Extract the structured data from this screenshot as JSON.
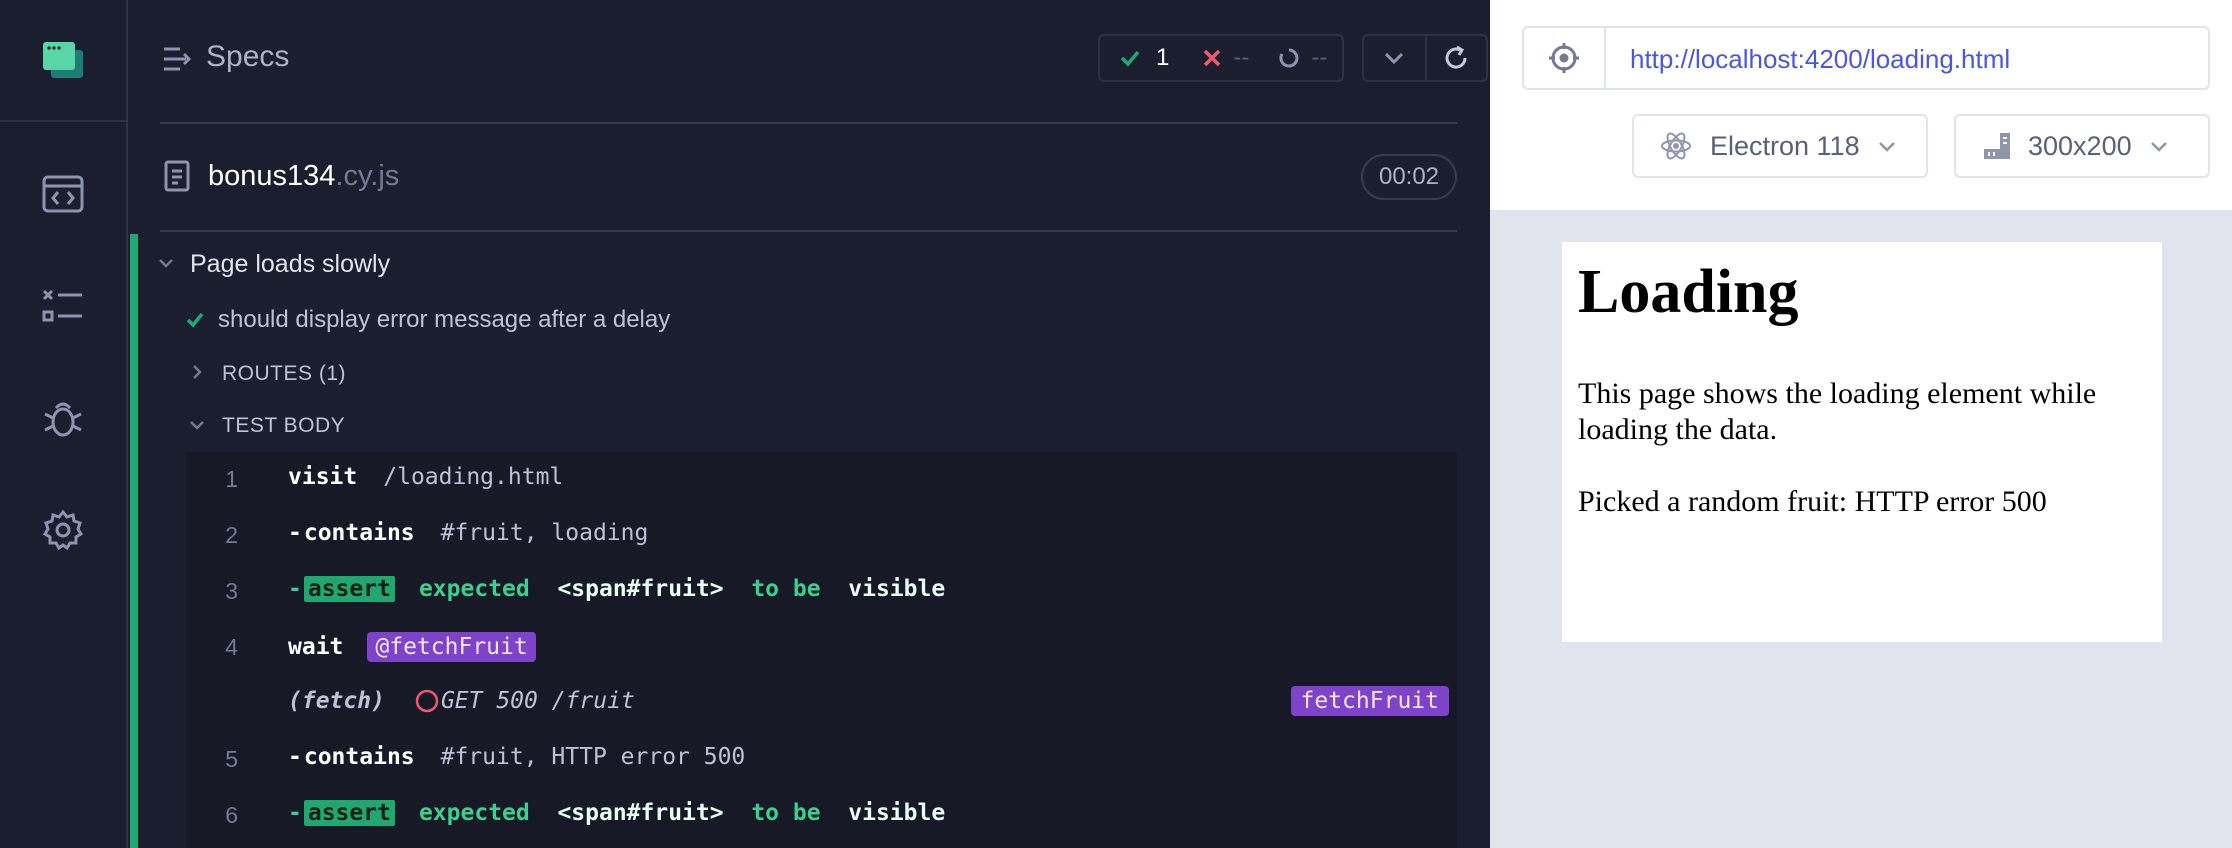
{
  "reporter": {
    "header": {
      "title": "Specs",
      "stats": {
        "passed": "1",
        "failed": "--",
        "pending": "--"
      }
    },
    "spec": {
      "name": "bonus134",
      "ext": ".cy.js",
      "duration": "00:02"
    },
    "suite": {
      "title": "Page loads slowly"
    },
    "test": {
      "title": "should display error message after a delay"
    },
    "sections": {
      "routes": "ROUTES (1)",
      "body": "TEST BODY"
    },
    "commands": [
      {
        "num": "1",
        "name": "visit",
        "message": "/loading.html"
      },
      {
        "num": "2",
        "dash": "-",
        "name": "contains",
        "message": "#fruit, loading"
      },
      {
        "num": "3",
        "dash": "-",
        "name": "assert",
        "parts": [
          "expected",
          "<span#fruit>",
          "to be",
          "visible"
        ]
      },
      {
        "num": "4",
        "name": "wait",
        "alias": "@fetchFruit"
      },
      {
        "kind": "(fetch)",
        "message": "GET 500 /fruit",
        "badge": "fetchFruit"
      },
      {
        "num": "5",
        "dash": "-",
        "name": "contains",
        "message": "#fruit, HTTP error 500"
      },
      {
        "num": "6",
        "dash": "-",
        "name": "assert",
        "parts": [
          "expected",
          "<span#fruit>",
          "to be",
          "visible"
        ]
      }
    ]
  },
  "aut": {
    "url": "http://localhost:4200/loading.html",
    "browser": "Electron 118",
    "viewport": "300x200",
    "page": {
      "heading": "Loading",
      "paragraph1": "This page shows the loading element while loading the data.",
      "paragraph2": "Picked a random fruit: HTTP error 500"
    }
  },
  "colors": {
    "pass": "#1fa971",
    "fail": "#f0566e",
    "alias": "#7f43c9",
    "link": "#4956e3"
  }
}
